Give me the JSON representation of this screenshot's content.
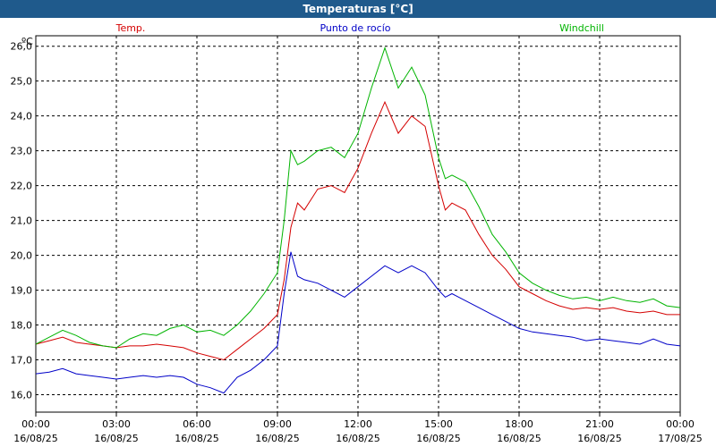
{
  "window": {
    "title": "Temperaturas [°C]"
  },
  "chart_data": {
    "type": "line",
    "title": "Temperaturas [°C]",
    "ylabel": "ºC",
    "xlabel": "",
    "ylim": [
      15.5,
      26.3
    ],
    "xlim": [
      0,
      24
    ],
    "grid": true,
    "y_ticks": [
      "16,0",
      "17,0",
      "18,0",
      "19,0",
      "20,0",
      "21,0",
      "22,0",
      "23,0",
      "24,0",
      "25,0",
      "26,0"
    ],
    "y_tick_values": [
      16,
      17,
      18,
      19,
      20,
      21,
      22,
      23,
      24,
      25,
      26
    ],
    "x_ticks": [
      {
        "time": "00:00",
        "date": "16/08/25",
        "h": 0
      },
      {
        "time": "03:00",
        "date": "16/08/25",
        "h": 3
      },
      {
        "time": "06:00",
        "date": "16/08/25",
        "h": 6
      },
      {
        "time": "09:00",
        "date": "16/08/25",
        "h": 9
      },
      {
        "time": "12:00",
        "date": "16/08/25",
        "h": 12
      },
      {
        "time": "15:00",
        "date": "16/08/25",
        "h": 15
      },
      {
        "time": "18:00",
        "date": "16/08/25",
        "h": 18
      },
      {
        "time": "21:00",
        "date": "16/08/25",
        "h": 21
      },
      {
        "time": "00:00",
        "date": "17/08/25",
        "h": 24
      }
    ],
    "x": [
      0,
      0.5,
      1,
      1.5,
      2,
      2.5,
      3,
      3.5,
      4,
      4.5,
      5,
      5.5,
      6,
      6.5,
      7,
      7.5,
      8,
      8.5,
      9,
      9.25,
      9.5,
      9.75,
      10,
      10.5,
      11,
      11.5,
      12,
      12.5,
      13,
      13.5,
      14,
      14.5,
      15,
      15.25,
      15.5,
      16,
      16.5,
      17,
      17.5,
      18,
      18.5,
      19,
      19.5,
      20,
      20.5,
      21,
      21.5,
      22,
      22.5,
      23,
      23.5,
      24
    ],
    "series": [
      {
        "name": "Temp.",
        "color": "#d40000",
        "values": [
          17.45,
          17.55,
          17.65,
          17.5,
          17.45,
          17.4,
          17.35,
          17.4,
          17.4,
          17.45,
          17.4,
          17.35,
          17.2,
          17.1,
          17.0,
          17.3,
          17.6,
          17.9,
          18.3,
          19.3,
          20.8,
          21.5,
          21.3,
          21.9,
          22.0,
          21.8,
          22.5,
          23.5,
          24.4,
          23.5,
          24.0,
          23.7,
          22.0,
          21.3,
          21.5,
          21.3,
          20.6,
          20.0,
          19.6,
          19.1,
          18.9,
          18.7,
          18.55,
          18.45,
          18.5,
          18.45,
          18.5,
          18.4,
          18.35,
          18.4,
          18.3,
          18.3
        ]
      },
      {
        "name": "Punto de rocío",
        "color": "#0000c8",
        "values": [
          16.6,
          16.65,
          16.75,
          16.6,
          16.55,
          16.5,
          16.45,
          16.5,
          16.55,
          16.5,
          16.55,
          16.5,
          16.3,
          16.2,
          16.05,
          16.5,
          16.7,
          17.0,
          17.4,
          18.9,
          20.1,
          19.4,
          19.3,
          19.2,
          19.0,
          18.8,
          19.1,
          19.4,
          19.7,
          19.5,
          19.7,
          19.5,
          19.0,
          18.8,
          18.9,
          18.7,
          18.5,
          18.3,
          18.1,
          17.9,
          17.8,
          17.75,
          17.7,
          17.65,
          17.55,
          17.6,
          17.55,
          17.5,
          17.45,
          17.6,
          17.45,
          17.4
        ]
      },
      {
        "name": "Windchill",
        "color": "#00b400",
        "values": [
          17.45,
          17.65,
          17.85,
          17.7,
          17.5,
          17.4,
          17.35,
          17.6,
          17.75,
          17.7,
          17.9,
          18.0,
          17.8,
          17.85,
          17.7,
          18.0,
          18.4,
          18.9,
          19.5,
          21.0,
          23.0,
          22.6,
          22.7,
          23.0,
          23.1,
          22.8,
          23.5,
          24.8,
          25.95,
          24.8,
          25.4,
          24.6,
          22.8,
          22.2,
          22.3,
          22.1,
          21.4,
          20.6,
          20.1,
          19.5,
          19.2,
          19.0,
          18.85,
          18.75,
          18.8,
          18.7,
          18.8,
          18.7,
          18.65,
          18.75,
          18.55,
          18.5
        ]
      }
    ]
  }
}
